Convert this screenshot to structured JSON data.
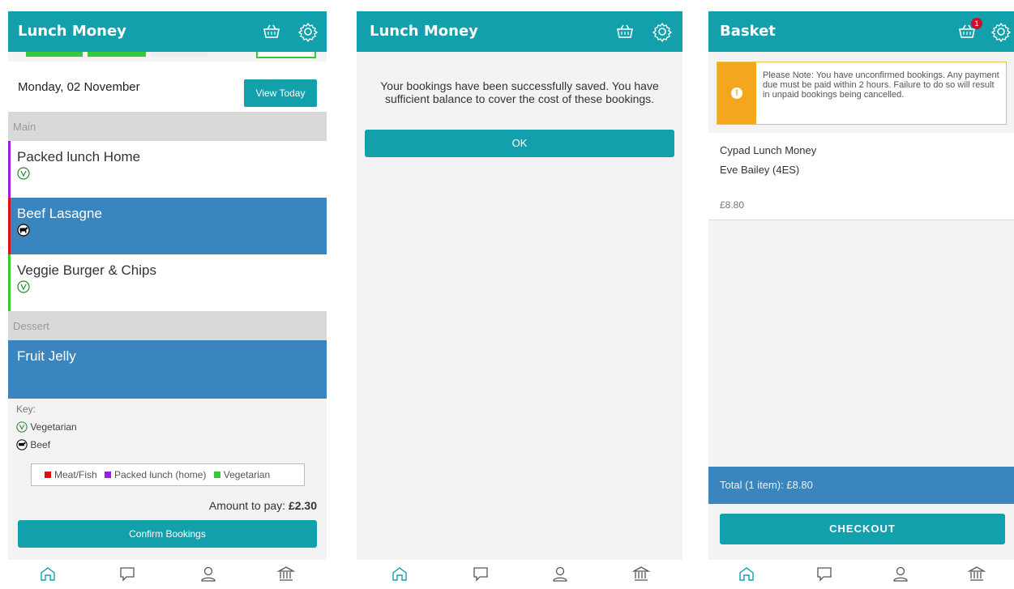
{
  "colors": {
    "teal": "#12a0ad",
    "blue": "#3a85bd",
    "meat": "#e01010",
    "packed": "#9b1de0",
    "veg": "#37c837",
    "notice": "#f4a61f"
  },
  "screen1": {
    "title": "Lunch Money",
    "date": "Monday, 02 November",
    "view_today": "View Today",
    "sections": {
      "main": "Main",
      "dessert": "Dessert"
    },
    "items": [
      {
        "label": "Packed lunch Home",
        "icon": "vegetarian-icon"
      },
      {
        "label": "Beef Lasagne",
        "icon": "beef-icon"
      },
      {
        "label": "Veggie Burger & Chips",
        "icon": "vegetarian-icon"
      },
      {
        "label": "Fruit Jelly"
      }
    ],
    "key": {
      "label": "Key:",
      "vegetarian": "Vegetarian",
      "beef": "Beef",
      "legend_meat": "Meat/Fish",
      "legend_packed": "Packed lunch (home)",
      "legend_veg": "Vegetarian"
    },
    "amount_label": "Amount to pay:",
    "amount_value": "£2.30",
    "confirm": "Confirm Bookings"
  },
  "screen2": {
    "title": "Lunch Money",
    "message": "Your bookings have been successfully saved. You have sufficient balance to cover the cost of these bookings.",
    "ok": "OK"
  },
  "screen3": {
    "title": "Basket",
    "badge": "1",
    "notice": "Please Note: You have unconfirmed bookings. Any payment due must be paid within 2 hours. Failure to do so will result in unpaid bookings being cancelled.",
    "line1": "Cypad Lunch Money",
    "line2": "Eve Bailey (4ES)",
    "price": "£8.80",
    "total": "Total (1 item): £8.80",
    "checkout": "CHECKOUT"
  }
}
